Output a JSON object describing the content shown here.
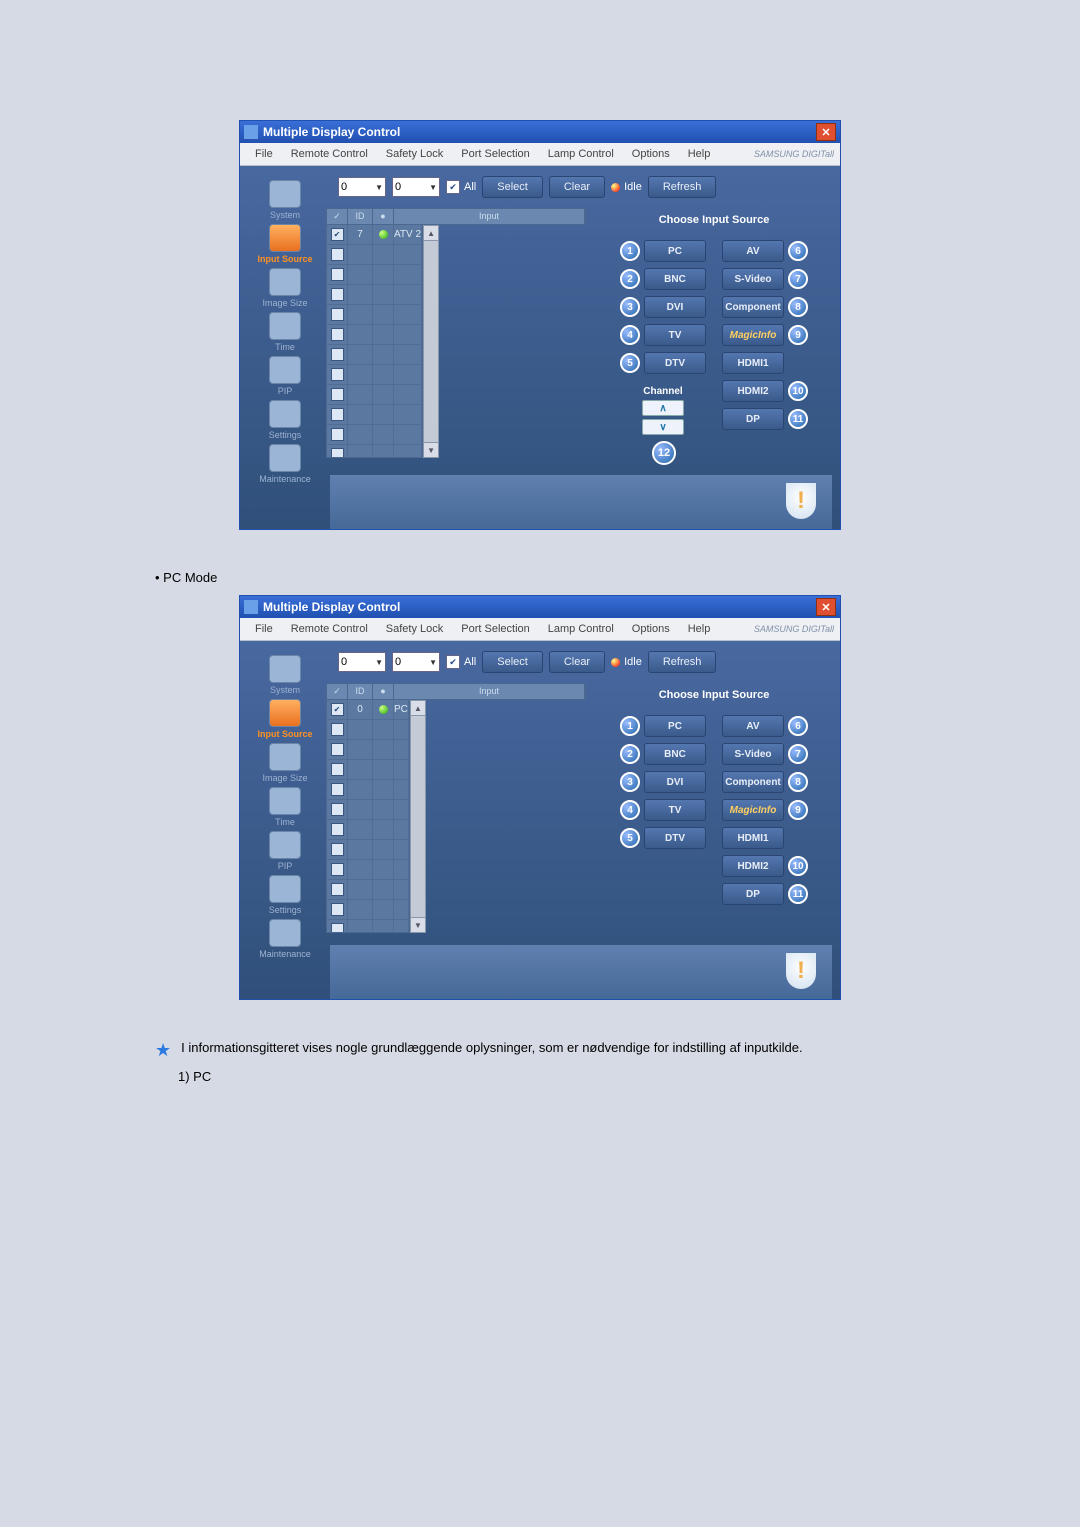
{
  "window_title": "Multiple Display Control",
  "menu": [
    "File",
    "Remote Control",
    "Safety Lock",
    "Port Selection",
    "Lamp Control",
    "Options",
    "Help"
  ],
  "brand": "SAMSUNG DIGITall",
  "toolbar": {
    "sel1": "0",
    "sel2": "0",
    "all_label": "All",
    "select": "Select",
    "clear": "Clear",
    "idle": "Idle",
    "refresh": "Refresh"
  },
  "sidebar": [
    {
      "label": "System"
    },
    {
      "label": "Input Source",
      "active": true
    },
    {
      "label": "Image Size"
    },
    {
      "label": "Time"
    },
    {
      "label": "PIP"
    },
    {
      "label": "Settings"
    },
    {
      "label": "Maintenance"
    }
  ],
  "grid_headers": {
    "id": "ID",
    "input": "Input"
  },
  "source_panel": {
    "title": "Choose Input Source",
    "left": [
      {
        "num": "1",
        "label": "PC"
      },
      {
        "num": "2",
        "label": "BNC"
      },
      {
        "num": "3",
        "label": "DVI"
      },
      {
        "num": "4",
        "label": "TV"
      },
      {
        "num": "5",
        "label": "DTV"
      }
    ],
    "right": [
      {
        "num": "6",
        "label": "AV"
      },
      {
        "num": "7",
        "label": "S-Video"
      },
      {
        "num": "8",
        "label": "Component"
      },
      {
        "num": "9",
        "label": "MagicInfo",
        "magic": true
      },
      {
        "num": "10",
        "label": "HDMI1"
      },
      {
        "num": "10",
        "label": "HDMI2",
        "hide_badge_top": true
      },
      {
        "num": "11",
        "label": "DP"
      }
    ],
    "channel_label": "Channel",
    "channel_badge": "12"
  },
  "screenshots": [
    {
      "row": {
        "checked": true,
        "id": "7",
        "status": true,
        "input": "ATV 2"
      },
      "show_channel": true,
      "right_source_buttons": [
        {
          "num": "6",
          "label": "AV"
        },
        {
          "num": "7",
          "label": "S-Video"
        },
        {
          "num": "8",
          "label": "Component"
        },
        {
          "num": "9",
          "label": "MagicInfo",
          "magic": true
        },
        {
          "num": "",
          "label": "HDMI1"
        },
        {
          "num": "10",
          "label": "HDMI2"
        },
        {
          "num": "11",
          "label": "DP"
        }
      ]
    },
    {
      "row": {
        "checked": true,
        "id": "0",
        "status": true,
        "input": "PC"
      },
      "show_channel": false,
      "right_source_buttons": [
        {
          "num": "6",
          "label": "AV"
        },
        {
          "num": "7",
          "label": "S-Video"
        },
        {
          "num": "8",
          "label": "Component"
        },
        {
          "num": "9",
          "label": "MagicInfo",
          "magic": true
        },
        {
          "num": "",
          "label": "HDMI1"
        },
        {
          "num": "10",
          "label": "HDMI2"
        },
        {
          "num": "11",
          "label": "DP"
        }
      ]
    }
  ],
  "note_between": "•  PC Mode",
  "footnote": "I informationsgitteret vises nogle grundlæggende oplysninger, som er nødvendige for indstilling af inputkilde.",
  "numbered": "1)   PC"
}
